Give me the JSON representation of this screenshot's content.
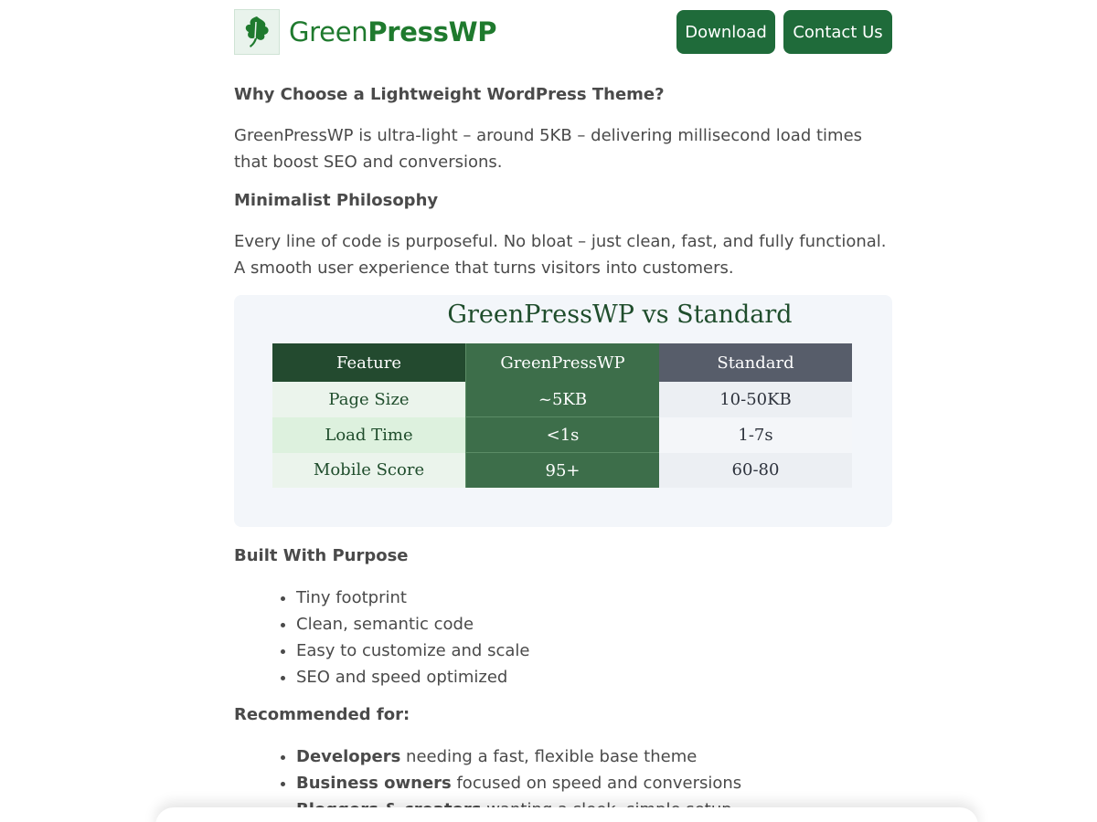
{
  "header": {
    "logo_text_light": "Green",
    "logo_text_bold": "PressWP",
    "download_label": "Download",
    "contact_label": "Contact Us"
  },
  "sections": {
    "why_heading": "Why Choose a Lightweight WordPress Theme?",
    "why_text": "GreenPressWP is ultra-light – around 5KB – delivering millisecond load times that boost SEO and conversions.",
    "min_heading": "Minimalist Philosophy",
    "min_text": "Every line of code is purposeful. No bloat – just clean, fast, and fully functional. A smooth user experience that turns visitors into customers.",
    "built_heading": "Built With Purpose",
    "built_items": [
      "Tiny footprint",
      "Clean, semantic code",
      "Easy to customize and scale",
      "SEO and speed optimized"
    ],
    "rec_heading": "Recommended for:",
    "rec_items": [
      {
        "bold": "Developers",
        "rest": " needing a fast, flexible base theme"
      },
      {
        "bold": "Business owners",
        "rest": " focused on speed and conversions"
      },
      {
        "bold": "Bloggers & creators",
        "rest": " wanting a sleek, simple setup"
      }
    ]
  },
  "comparison": {
    "title": "GreenPressWP vs Standard",
    "headers": [
      "Feature",
      "GreenPressWP",
      "Standard"
    ],
    "rows": [
      [
        "Page Size",
        "~5KB",
        "10-50KB"
      ],
      [
        "Load Time",
        "<1s",
        "1-7s"
      ],
      [
        "Mobile Score",
        "95+",
        "60-80"
      ]
    ]
  },
  "colors": {
    "brand_green": "#1f6b3a",
    "logo_green": "#1f7a2e",
    "table_header_dark": "#234a2f",
    "table_green_col": "#3d6e4a",
    "table_standard_header": "#575d6a",
    "card_bg": "#f3f6fa"
  },
  "icons": {
    "logo": "leaf-icon"
  }
}
